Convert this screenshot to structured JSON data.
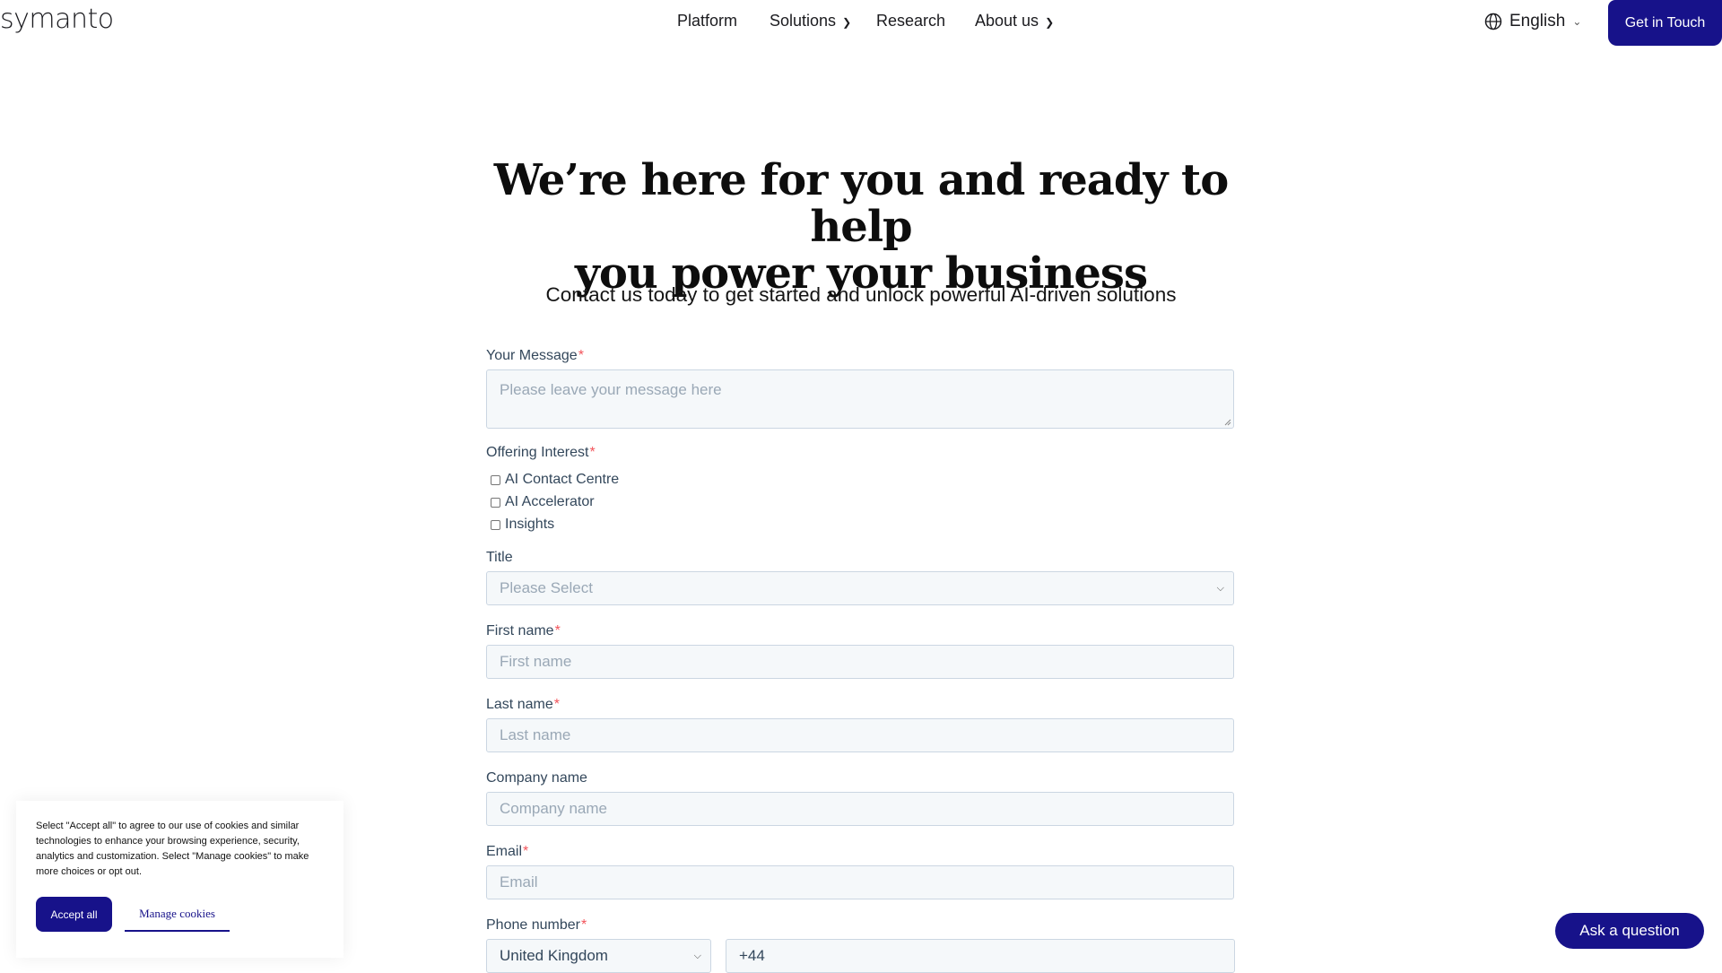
{
  "header": {
    "logo": "symanto",
    "nav": [
      {
        "label": "Platform"
      },
      {
        "label": "Solutions"
      },
      {
        "label": "Research"
      },
      {
        "label": "About us"
      }
    ],
    "language": "English",
    "cta": "Get in Touch"
  },
  "hero": {
    "title_line1": "We’re here for you and ready to help",
    "title_line2": "you power your business",
    "subtitle": "Contact us today to get started and unlock powerful AI-driven solutions"
  },
  "form": {
    "message": {
      "label": "Your Message",
      "required": "*",
      "placeholder": "Please leave your message here"
    },
    "offering": {
      "label": "Offering Interest",
      "required": "*",
      "options": [
        "AI Contact Centre",
        "AI Accelerator",
        "Insights"
      ]
    },
    "title": {
      "label": "Title",
      "placeholder": "Please Select"
    },
    "first_name": {
      "label": "First name",
      "required": "*",
      "placeholder": "First name"
    },
    "last_name": {
      "label": "Last name",
      "required": "*",
      "placeholder": "Last name"
    },
    "company": {
      "label": "Company name",
      "placeholder": "Company name"
    },
    "email": {
      "label": "Email",
      "required": "*",
      "placeholder": "Email"
    },
    "phone": {
      "label": "Phone number",
      "required": "*",
      "country": "United Kingdom",
      "code": "+44"
    }
  },
  "cookie": {
    "text": "Select \"Accept all\" to agree to our use of cookies and similar technologies to enhance your browsing experience, security, analytics and customization. Select \"Manage cookies\" to make more choices or opt out.",
    "accept": "Accept all",
    "manage": "Manage cookies"
  },
  "chat": {
    "label": "Ask a question"
  },
  "colors": {
    "brand": "#17128a",
    "field_bg": "#f5f8fa",
    "required": "#f2545b"
  }
}
